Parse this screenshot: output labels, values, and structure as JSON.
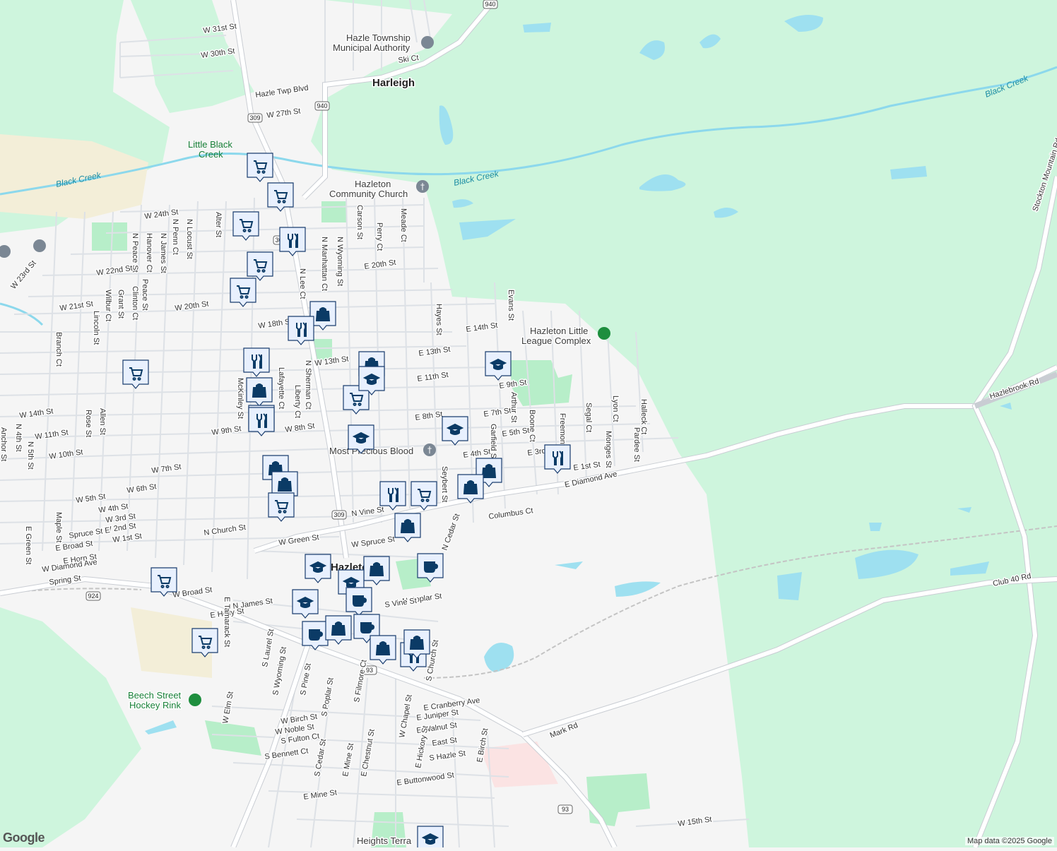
{
  "colors": {
    "background": "#f5f5f5",
    "green_area": "#cef5dd",
    "park": "#b7eec9",
    "water": "#9ee0f0",
    "urban_sand": "#f3eed8",
    "marker": "#0b3b66"
  },
  "places": [
    {
      "name": "Harleigh"
    },
    {
      "name": "Hazleton"
    }
  ],
  "pois": [
    {
      "name": "Hazle Township Municipal Authority",
      "line1": "Hazle Township",
      "line2": "Municipal Authority",
      "icon": "government-icon"
    },
    {
      "name": "Hazleton Community Church",
      "line1": "Hazleton",
      "line2": "Community Church",
      "icon": "church-icon"
    },
    {
      "name": "Hazleton Little League Complex",
      "line1": "Hazleton Little",
      "line2": "League Complex",
      "icon": "park-icon"
    },
    {
      "name": "Most Precious Blood",
      "line1": "Most Precious Blood",
      "line2": "",
      "icon": "church-icon"
    },
    {
      "name": "Beech Street Hockey Rink",
      "line1": "Beech Street",
      "line2": "Hockey Rink",
      "icon": "park-icon"
    },
    {
      "name": "Heights Terrace",
      "line1": "Heights Terra",
      "line2": "",
      "icon": "school-icon"
    }
  ],
  "water_labels": [
    "Black Creek",
    "Black Creek",
    "Black Creek",
    "Little Black",
    "Creek"
  ],
  "streets": [
    "W 31st St",
    "W 30th St",
    "Hazle Twp Blvd",
    "W 27th St",
    "Ski Ct",
    "W 24th St",
    "N Locust St",
    "N Penn Ct",
    "Hanover Ct",
    "N James St",
    "N Peace St",
    "Alter St",
    "W 22nd St",
    "Clinton Ct",
    "Peace St",
    "Grant St",
    "Wilbur Ct",
    "W 21st St",
    "Lincoln St",
    "W 23rd St",
    "W 20th St",
    "W 18th St",
    "N Lee Ct",
    "N Manhattan Ct",
    "N Wyoming St",
    "Carson St",
    "Perry Ct",
    "Meade Ct",
    "E 20th St",
    "Evans St",
    "Hayes St",
    "E 14th St",
    "E 13th St",
    "E 11th St",
    "E 9th St",
    "E 8th St",
    "E 7th St",
    "E 5th St",
    "E 4th St",
    "E 3rd St",
    "E 1st St",
    "Arthur St",
    "Boone Ct",
    "Freemont St",
    "Segal Ct",
    "Lyon Ct",
    "Halleck Ct",
    "Monges St",
    "Pardee St",
    "Garfield St",
    "Seybert St",
    "N Cedar St",
    "E Diamond Ave",
    "Columbus Ct",
    "Hazlebrook Rd",
    "Stockton Mountain Rd",
    "Club 40 Rd",
    "Mark Rd",
    "W 15th St",
    "W 14th St",
    "W 13th St",
    "W 11th St",
    "W 10th St",
    "W 9th St",
    "W 8th St",
    "W 7th St",
    "W 6th St",
    "W 5th St",
    "W 4th St",
    "W 3rd St",
    "W 2nd St",
    "W 1st St",
    "N Church St",
    "N Vine St",
    "N Sherman Ct",
    "Lafayette Ct",
    "Liberty Ct",
    "McKinley St",
    "Branch Ct",
    "Rose St",
    "Allen St",
    "Anchor St",
    "N 4th St",
    "N 5th St",
    "Maple St",
    "E Green St",
    "Spruce St E",
    "E Broad St",
    "E Horn St",
    "W Diamond Ave",
    "Spring St",
    "W Green St",
    "W Spruce St",
    "W Broad St",
    "N James St",
    "E Holly St",
    "E Tamarack St",
    "N Poplar St",
    "S Vine St",
    "S Church St",
    "S Laurel St",
    "S Wyoming St",
    "S Pine St",
    "S Poplar St",
    "S Filmore Ct",
    "W Chapel St",
    "W Elm St",
    "W Birch St",
    "W Noble St",
    "S Fulton Ct",
    "S Bennett Ct",
    "S Cedar St",
    "E Mine St",
    "E Chestnut St",
    "E Cranberry Ave",
    "E Juniper St",
    "E Walnut St",
    "East St",
    "S Hazle St",
    "E Birch St",
    "E Hickory St",
    "E Buttonwood St",
    "E Mine St"
  ],
  "route_shields": [
    "940",
    "940",
    "309",
    "309",
    "309",
    "924",
    "93",
    "93"
  ],
  "markers": [
    {
      "type": "shopping-cart-icon"
    },
    {
      "type": "shopping-cart-icon"
    },
    {
      "type": "shopping-cart-icon"
    },
    {
      "type": "restaurant-icon"
    },
    {
      "type": "shopping-cart-icon"
    },
    {
      "type": "shopping-cart-icon"
    },
    {
      "type": "shopping-bag-icon"
    },
    {
      "type": "restaurant-icon"
    },
    {
      "type": "restaurant-icon"
    },
    {
      "type": "shopping-bag-icon"
    },
    {
      "type": "school-icon"
    },
    {
      "type": "shopping-cart-icon"
    },
    {
      "type": "shopping-cart-icon"
    },
    {
      "type": "shopping-bag-icon"
    },
    {
      "type": "restaurant-icon"
    },
    {
      "type": "school-icon"
    },
    {
      "type": "school-icon"
    },
    {
      "type": "restaurant-icon"
    },
    {
      "type": "school-icon"
    },
    {
      "type": "restaurant-icon"
    },
    {
      "type": "shopping-bag-icon"
    },
    {
      "type": "shopping-bag-icon"
    },
    {
      "type": "shopping-cart-icon"
    },
    {
      "type": "restaurant-icon"
    },
    {
      "type": "shopping-cart-icon"
    },
    {
      "type": "shopping-bag-icon"
    },
    {
      "type": "shopping-bag-icon"
    },
    {
      "type": "shopping-bag-icon"
    },
    {
      "type": "coffee-icon"
    },
    {
      "type": "school-icon"
    },
    {
      "type": "shopping-bag-icon"
    },
    {
      "type": "school-icon"
    },
    {
      "type": "coffee-icon"
    },
    {
      "type": "shopping-cart-icon"
    },
    {
      "type": "school-icon"
    },
    {
      "type": "coffee-icon"
    },
    {
      "type": "shopping-bag-icon"
    },
    {
      "type": "coffee-icon"
    },
    {
      "type": "shopping-bag-icon"
    },
    {
      "type": "restaurant-icon"
    },
    {
      "type": "shopping-bag-icon"
    },
    {
      "type": "shopping-cart-icon"
    },
    {
      "type": "school-icon"
    }
  ],
  "attribution": "Map data ©2025 Google",
  "logo": "Google"
}
